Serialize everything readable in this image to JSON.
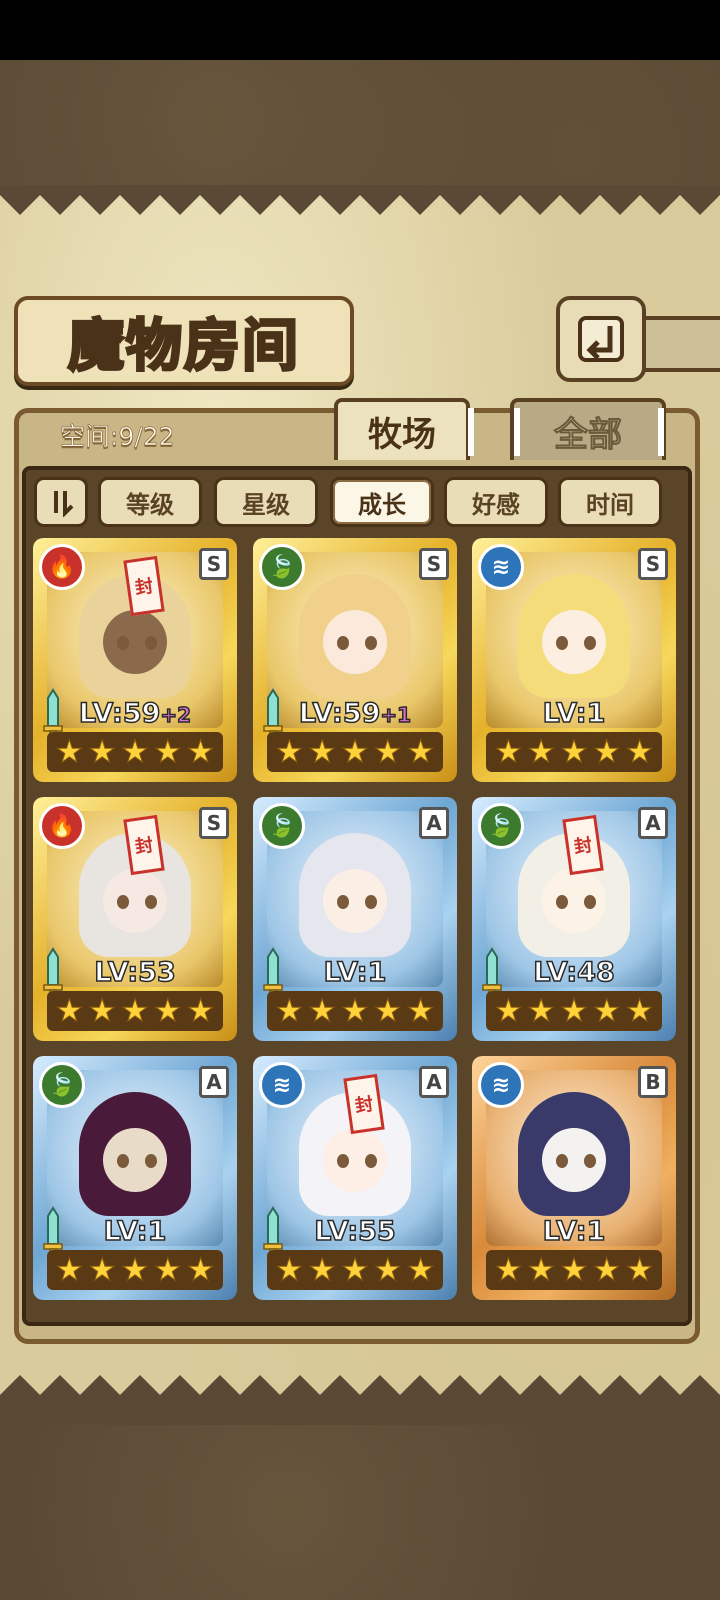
{
  "title": "魔物房间",
  "back_icon": "return-arrow-icon",
  "space_label": "空间:9/22",
  "tabs": [
    {
      "label": "牧场",
      "active": true
    },
    {
      "label": "全部",
      "active": false
    }
  ],
  "sort": {
    "toggle_icon": "sort-order-icon",
    "buttons": [
      {
        "label": "等级",
        "active": false
      },
      {
        "label": "星级",
        "active": false
      },
      {
        "label": "成长",
        "active": true
      },
      {
        "label": "好感",
        "active": false
      },
      {
        "label": "时间",
        "active": false
      }
    ]
  },
  "monsters": [
    {
      "element": "fire",
      "rank": "S",
      "frame": "gold",
      "level": "LV:59",
      "bonus": "+2",
      "stars": 5,
      "sealed": true,
      "has_sword": true,
      "hair": "#e9d39a",
      "skin": "#8a6a4a"
    },
    {
      "element": "leaf",
      "rank": "S",
      "frame": "gold",
      "level": "LV:59",
      "bonus": "+1",
      "stars": 5,
      "sealed": false,
      "has_sword": true,
      "hair": "#f0d08a",
      "skin": "#fbe9dc"
    },
    {
      "element": "water",
      "rank": "S",
      "frame": "gold",
      "level": "LV:1",
      "bonus": "",
      "stars": 5,
      "sealed": false,
      "has_sword": false,
      "hair": "#f5dc7a",
      "skin": "#fdeee2"
    },
    {
      "element": "fire",
      "rank": "S",
      "frame": "gold",
      "level": "LV:53",
      "bonus": "",
      "stars": 5,
      "sealed": true,
      "has_sword": true,
      "hair": "#e8e4e0",
      "skin": "#f6e8e2"
    },
    {
      "element": "leaf",
      "rank": "A",
      "frame": "blue",
      "level": "LV:1",
      "bonus": "",
      "stars": 5,
      "sealed": false,
      "has_sword": true,
      "hair": "#e6e6ee",
      "skin": "#fbeee4"
    },
    {
      "element": "leaf",
      "rank": "A",
      "frame": "blue",
      "level": "LV:48",
      "bonus": "",
      "stars": 5,
      "sealed": true,
      "has_sword": true,
      "hair": "#f2f0e6",
      "skin": "#fdf2e6"
    },
    {
      "element": "leaf",
      "rank": "A",
      "frame": "blue",
      "level": "LV:1",
      "bonus": "",
      "stars": 5,
      "sealed": false,
      "has_sword": true,
      "hair": "#4a1a3a",
      "skin": "#e8dcc8"
    },
    {
      "element": "water",
      "rank": "A",
      "frame": "blue",
      "level": "LV:55",
      "bonus": "",
      "stars": 5,
      "sealed": true,
      "has_sword": true,
      "hair": "#f4f4f8",
      "skin": "#fdeee6"
    },
    {
      "element": "water",
      "rank": "B",
      "frame": "bronze",
      "level": "LV:1",
      "bonus": "",
      "stars": 5,
      "sealed": false,
      "has_sword": false,
      "hair": "#3a3a6a",
      "skin": "#f4f2f0"
    }
  ],
  "colors": {
    "parchment": "#d9cb9b",
    "frame_brown": "#5a4022",
    "star": "#ffd23a"
  }
}
